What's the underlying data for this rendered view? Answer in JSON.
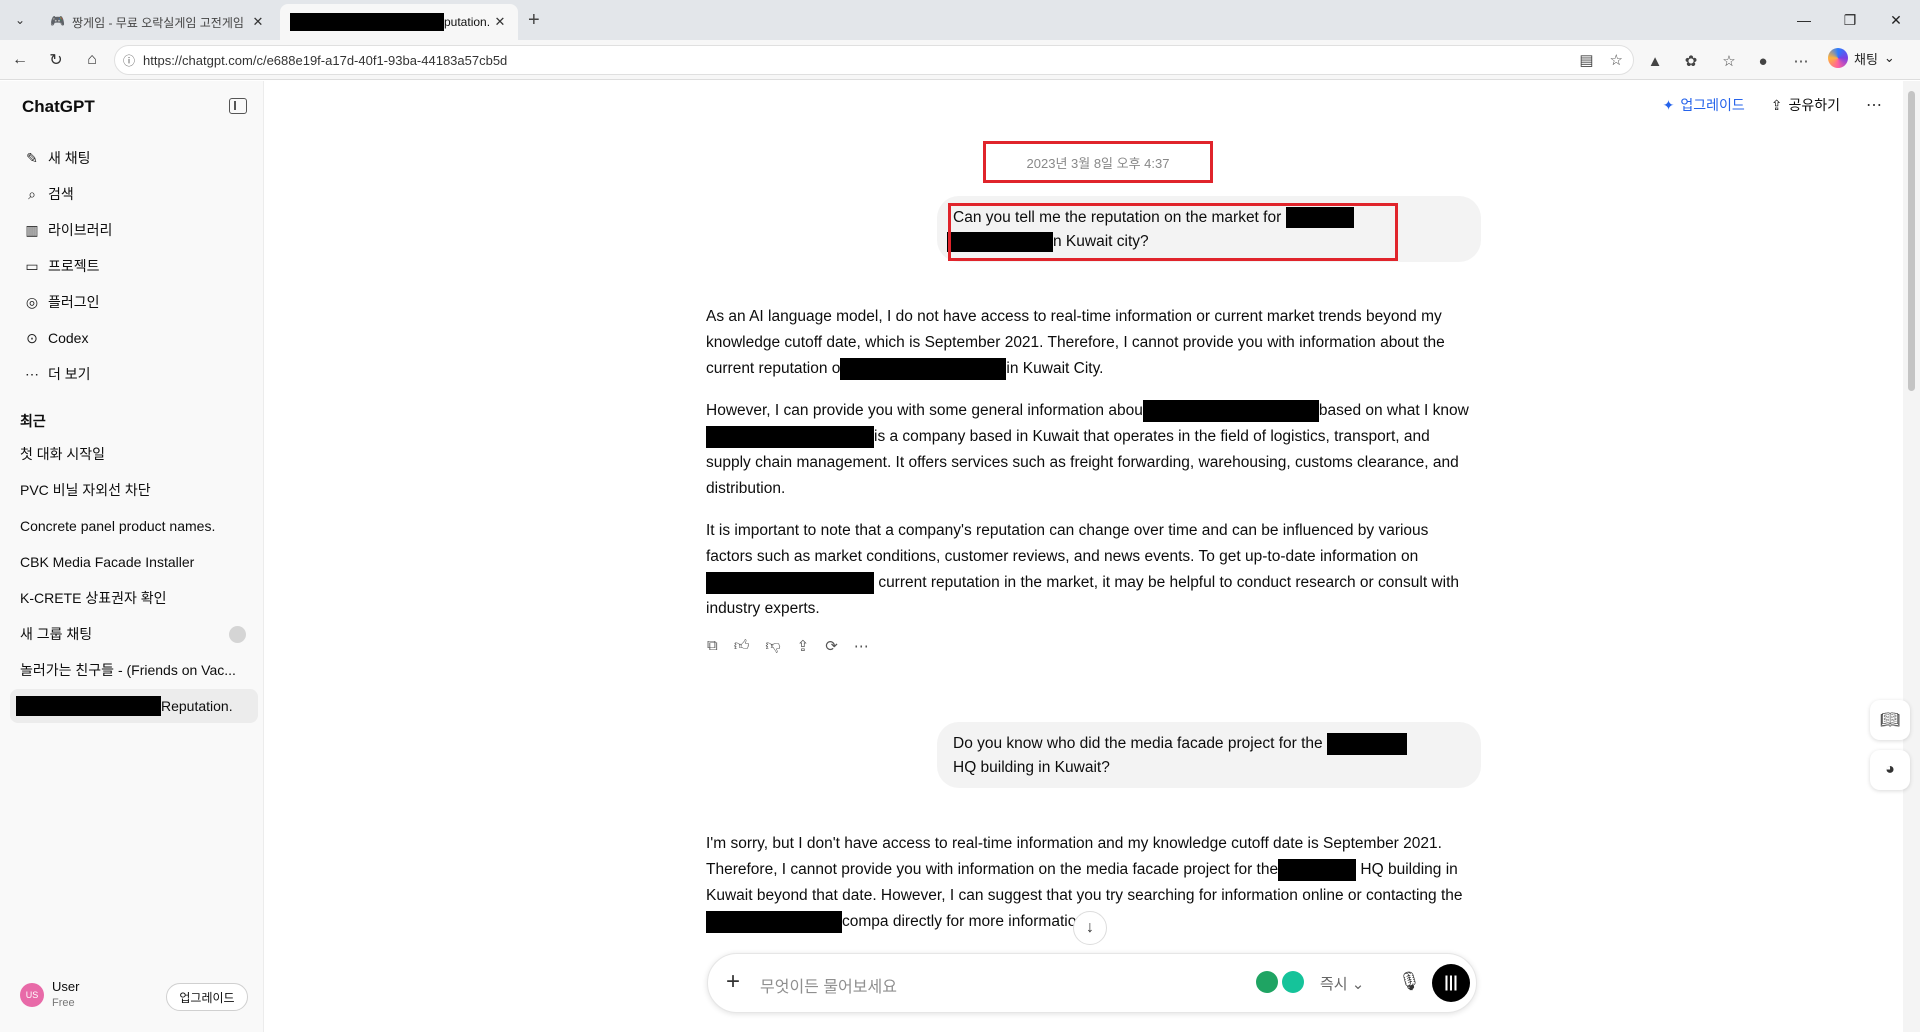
{
  "browser": {
    "tabs": [
      {
        "title": "짱게임 - 무료 오락실게임 고전게임",
        "active": false
      },
      {
        "title_suffix": "putation.",
        "active": true
      }
    ],
    "url": "https://chatgpt.com/c/e688e19f-a17d-40f1-93ba-44183a57cb5d",
    "copilot_label": "채팅"
  },
  "sidebar": {
    "brand": "ChatGPT",
    "nav": [
      {
        "label": "새 채팅",
        "icon": "compose-icon"
      },
      {
        "label": "검색",
        "icon": "search-icon"
      },
      {
        "label": "라이브러리",
        "icon": "library-icon"
      },
      {
        "label": "프로젝트",
        "icon": "folder-icon"
      },
      {
        "label": "플러그인",
        "icon": "plugin-icon"
      },
      {
        "label": "Codex",
        "icon": "codex-icon"
      },
      {
        "label": "더 보기",
        "icon": "more-icon"
      }
    ],
    "recent_label": "최근",
    "recent": [
      {
        "label": "첫 대화 시작일"
      },
      {
        "label": "PVC 비닐 자외선 차단"
      },
      {
        "label": "Concrete panel product names."
      },
      {
        "label": "CBK Media Facade Installer"
      },
      {
        "label": "K-CRETE 상표권자 확인"
      },
      {
        "label": "새 그룹 채팅"
      },
      {
        "label": "놀러가는 친구들 - (Friends on Vac..."
      },
      {
        "label_suffix": "Reputation."
      }
    ],
    "user": {
      "initials": "US",
      "name": "User",
      "plan": "Free",
      "upgrade": "업그레이드"
    }
  },
  "header": {
    "upgrade": "업그레이드",
    "share": "공유하기"
  },
  "conversation": {
    "date_stamp": "2023년 3월 8일 오후 4:37",
    "q1_a": "Can you tell me the reputation on the market for",
    "q1_b": "n Kuwait city?",
    "a1_p1_a": "As an AI language model, I do not have access to real-time information or current market trends beyond my knowledge cutoff date, which is September 2021. Therefore, I cannot provide you with information about the current reputation o",
    "a1_p1_b": "in Kuwait City.",
    "a1_p2_a": "However, I can provide you with some general information abou",
    "a1_p2_b": "based on what I know",
    "a1_p2_c": "is a company based in Kuwait that operates in the field of logistics, transport, and supply chain management. It offers services such as freight forwarding, warehousing, customs clearance, and distribution.",
    "a1_p3_a": "It is important to note that a company's reputation can change over time and can be influenced by various factors such as market conditions, customer reviews, and news events. To get up-to-date information on",
    "a1_p3_b": "current reputation in the market, it may be helpful to conduct research or consult with industry experts.",
    "q2_a": "Do you know who did the media facade project for the",
    "q2_b": "HQ building in Kuwait?",
    "a2_a": "I'm sorry, but I don't have access to real-time information and my knowledge cutoff date is September 2021. Therefore, I cannot provide you with information on the media facade project for the",
    "a2_b": "HQ building in Kuwait beyond that date. However, I can suggest that you try searching for information online or contacting the",
    "a2_c": "compa",
    "a2_d": "directly for more information."
  },
  "composer": {
    "placeholder": "무엇이든 물어보세요",
    "mode": "즉시"
  },
  "colors": {
    "accent": "#2563eb",
    "annotation": "#e0242b"
  }
}
